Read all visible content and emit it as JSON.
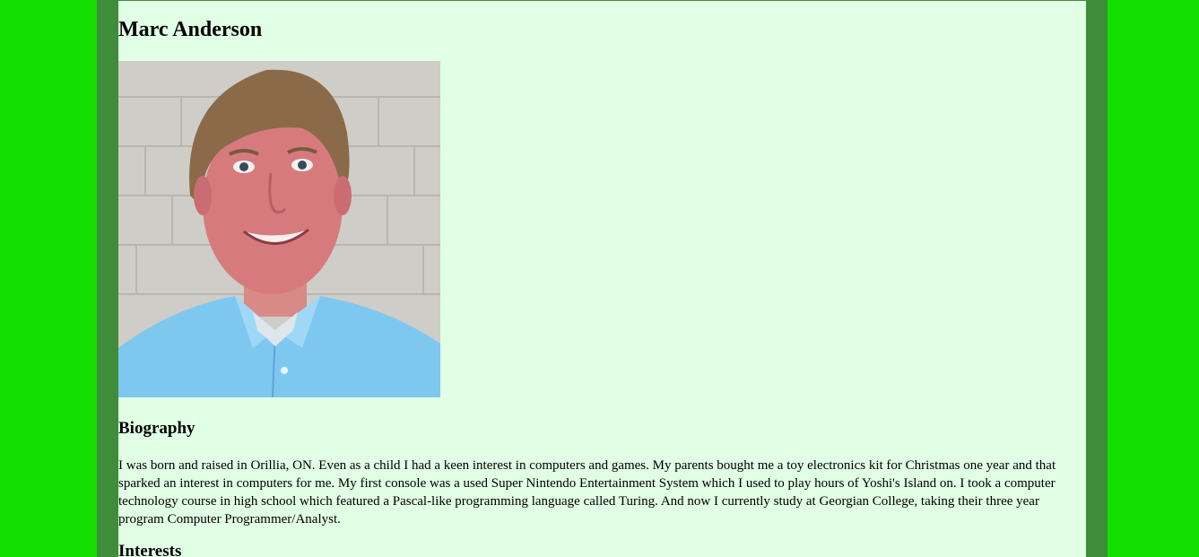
{
  "profile": {
    "name": "Marc Anderson",
    "photo_subject": "portrait photo of a smiling young man with brown hair in a light blue collared shirt against a white brick wall"
  },
  "biography": {
    "heading": "Biography",
    "text": "I was born and raised in Orillia, ON. Even as a child I had a keen interest in computers and games. My parents bought me a toy electronics kit for Christmas one year and that sparked an interest in computers for me. My first console was a used Super Nintendo Entertainment System which I used to play hours of Yoshi's Island on. I took a computer technology course in high school which featured a Pascal-like programming language called Turing. And now I currently study at Georgian College, taking their three year program Computer Programmer/Analyst."
  },
  "interests": {
    "heading": "Interests"
  },
  "colors": {
    "page_background": "#14e000",
    "frame": "#3f8c3a",
    "panel": "#e1ffe4",
    "shirt": "#7ec8f0"
  }
}
